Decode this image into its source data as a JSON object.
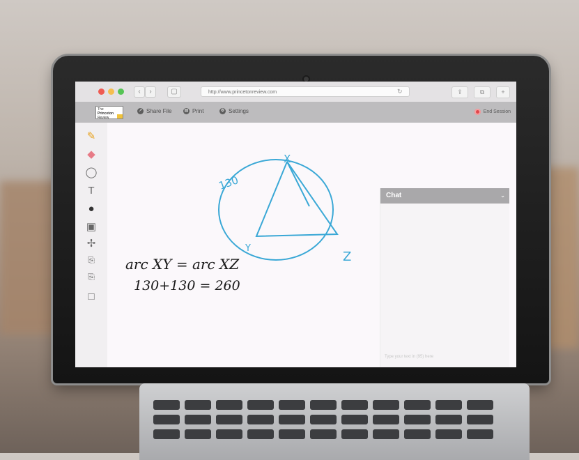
{
  "browser": {
    "url": "http://www.princetonreview.com"
  },
  "app": {
    "logo_lines": [
      "The",
      "Princeton",
      "Review"
    ],
    "menu": [
      {
        "label": "Share File",
        "icon": "share-icon"
      },
      {
        "label": "Print",
        "icon": "print-icon"
      },
      {
        "label": "Settings",
        "icon": "settings-icon"
      }
    ],
    "end_session_label": "End Session"
  },
  "toolbar": {
    "tools": [
      "pencil-icon",
      "eraser-icon",
      "circle-shape-icon",
      "text-icon",
      "fill-bucket-icon",
      "image-icon",
      "move-icon",
      "copy-icon",
      "paste-icon",
      "square-shape-icon"
    ]
  },
  "whiteboard": {
    "label_130": "130",
    "label_x": "X",
    "label_y": "Y",
    "label_z": "Z",
    "equation_1": "arc XY = arc XZ",
    "equation_2": "130+130 = 260"
  },
  "chat": {
    "title": "Chat",
    "input_placeholder": "Type your text in (95) here"
  },
  "colors": {
    "ink_blue": "#3aa8d6",
    "ink_black": "#1a1a1a",
    "end_session_red": "#e0474c"
  }
}
